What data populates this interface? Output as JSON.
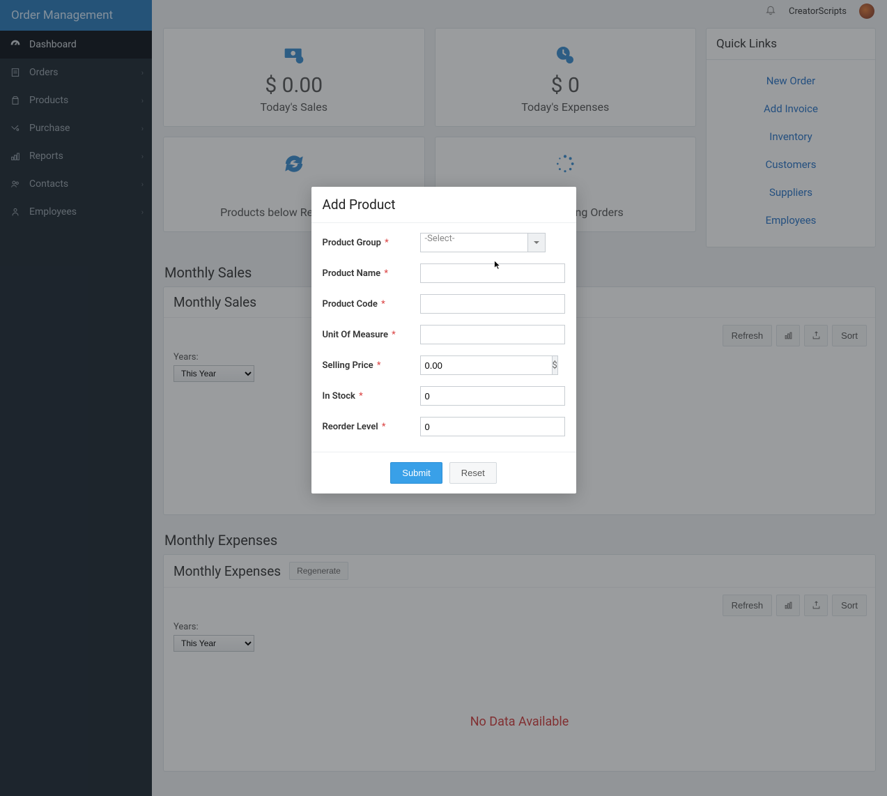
{
  "app_title": "Order Management",
  "user_name": "CreatorScripts",
  "nav": [
    {
      "label": "Dashboard",
      "active": true,
      "expandable": false
    },
    {
      "label": "Orders",
      "active": false,
      "expandable": true
    },
    {
      "label": "Products",
      "active": false,
      "expandable": true
    },
    {
      "label": "Purchase",
      "active": false,
      "expandable": true
    },
    {
      "label": "Reports",
      "active": false,
      "expandable": true
    },
    {
      "label": "Contacts",
      "active": false,
      "expandable": true
    },
    {
      "label": "Employees",
      "active": false,
      "expandable": true
    }
  ],
  "cards": {
    "todays_sales": {
      "value": "$ 0.00",
      "label": "Today's Sales"
    },
    "todays_expenses": {
      "value": "$ 0",
      "label": "Today's Expenses"
    },
    "reorder": {
      "label": "Products below Reorder Level"
    },
    "pending": {
      "label": "Today's Pending Orders"
    }
  },
  "quicklinks": {
    "title": "Quick Links",
    "items": [
      "New Order",
      "Add Invoice",
      "Inventory",
      "Customers",
      "Suppliers",
      "Employees"
    ]
  },
  "monthly_sales": {
    "section_title": "Monthly Sales",
    "panel_title": "Monthly Sales",
    "years_label": "Years:",
    "year_value": "This Year",
    "refresh": "Refresh",
    "sort": "Sort"
  },
  "monthly_expenses": {
    "section_title": "Monthly Expenses",
    "panel_title": "Monthly Expenses",
    "regenerate": "Regenerate",
    "years_label": "Years:",
    "year_value": "This Year",
    "refresh": "Refresh",
    "sort": "Sort",
    "nodata": "No Data Available"
  },
  "modal": {
    "title": "Add Product",
    "fields": {
      "product_group": {
        "label": "Product Group",
        "placeholder": "-Select-"
      },
      "product_name": {
        "label": "Product Name",
        "value": ""
      },
      "product_code": {
        "label": "Product Code",
        "value": ""
      },
      "unit_of_measure": {
        "label": "Unit Of Measure",
        "value": ""
      },
      "selling_price": {
        "label": "Selling Price",
        "value": "0.00",
        "currency": "$"
      },
      "in_stock": {
        "label": "In Stock",
        "value": "0"
      },
      "reorder_level": {
        "label": "Reorder Level",
        "value": "0"
      }
    },
    "submit": "Submit",
    "reset": "Reset",
    "required_marker": "*"
  }
}
